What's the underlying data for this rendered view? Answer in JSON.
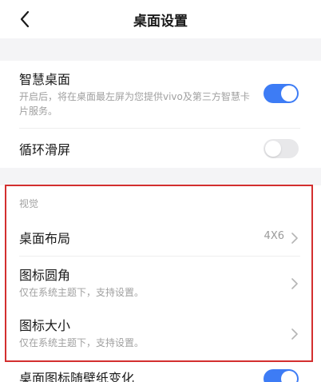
{
  "header": {
    "title": "桌面设置"
  },
  "smart_desktop": {
    "label": "智慧桌面",
    "description": "开启后，将在桌面最左屏为您提供vivo及第三方智慧卡片服务。",
    "enabled": true
  },
  "cyclic_scroll": {
    "label": "循环滑屏",
    "enabled": false
  },
  "visual_section": {
    "title": "视觉",
    "items": [
      {
        "label": "桌面布局",
        "value": "4X6"
      },
      {
        "label": "图标圆角",
        "description": "仅在系统主题下，支持设置。"
      },
      {
        "label": "图标大小",
        "description": "仅在系统主题下，支持设置。"
      }
    ]
  },
  "icon_wallpaper": {
    "label": "桌面图标随壁纸变化",
    "enabled": true
  },
  "colors": {
    "accent": "#3d7cf5",
    "highlight_border": "#d32f2f"
  }
}
